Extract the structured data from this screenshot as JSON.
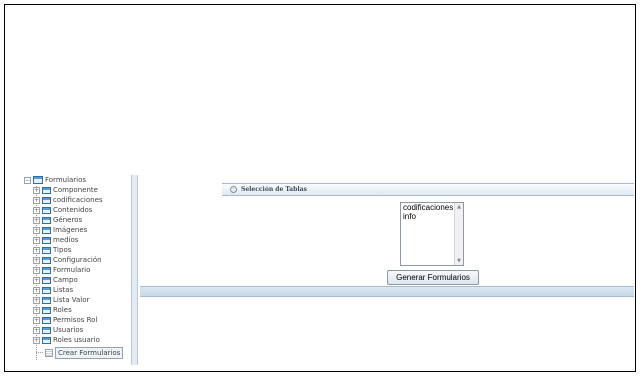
{
  "tree": {
    "root_label": "Formularios",
    "items": [
      {
        "label": "Componente"
      },
      {
        "label": "codificaciones"
      },
      {
        "label": "Contenidos"
      },
      {
        "label": "Géneros"
      },
      {
        "label": "Imágenes"
      },
      {
        "label": "medios"
      },
      {
        "label": "Tipos"
      },
      {
        "label": "Configuración"
      },
      {
        "label": "Formulario"
      },
      {
        "label": "Campo"
      },
      {
        "label": "Listas"
      },
      {
        "label": "Lista Valor"
      },
      {
        "label": "Roles"
      },
      {
        "label": "Permisos Rol"
      },
      {
        "label": "Usuarios"
      },
      {
        "label": "Roles usuario"
      }
    ],
    "selected_leaf": "Crear Formularios"
  },
  "section": {
    "title": "Selección de Tablas"
  },
  "tables_list": {
    "options": [
      "codificaciones",
      "info"
    ]
  },
  "actions": {
    "generate_label": "Generar Formularios"
  },
  "colors": {
    "header_border": "#a9bccd",
    "icon_blue": "#2f6ea8",
    "bar_fill": "#c7d8e8"
  },
  "icons": {
    "expand": "plus-box-icon",
    "collapse_root": "minus-box-icon",
    "table": "table-icon",
    "document": "document-icon",
    "section_toggle": "circle-collapse-icon"
  }
}
